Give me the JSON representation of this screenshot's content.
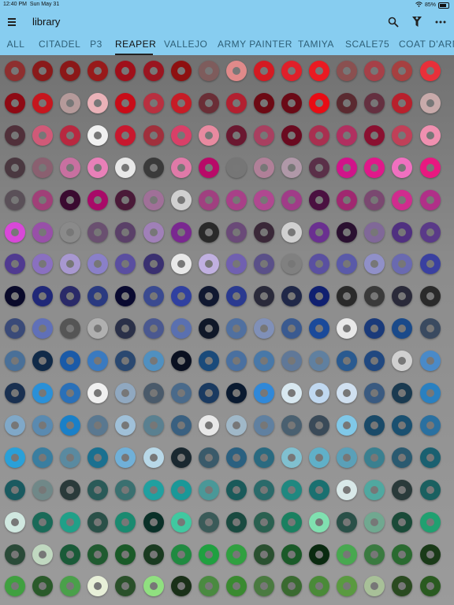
{
  "status_bar": {
    "time": "12:40 PM",
    "date": "Sun May 31",
    "battery": "85%"
  },
  "app_bar": {
    "title": "library"
  },
  "icons": {
    "menu": "hamburger-menu-icon",
    "search": "search-icon",
    "filter": "filter-icon",
    "more": "more-options-icon"
  },
  "tabs": [
    {
      "label": "ALL",
      "active": false
    },
    {
      "label": "CITADEL",
      "active": false
    },
    {
      "label": "P3",
      "active": false
    },
    {
      "label": "REAPER",
      "active": true
    },
    {
      "label": "VALLEJO",
      "active": false
    },
    {
      "label": "ARMY PAINTER",
      "active": false
    },
    {
      "label": "TAMIYA",
      "active": false
    },
    {
      "label": "SCALE75",
      "active": false
    },
    {
      "label": "COAT D'ARM",
      "active": false
    }
  ],
  "swatch_rows": [
    [
      "#8e2f2f",
      "#8a1a1a",
      "#8b1818",
      "#981a1a",
      "#a0101a",
      "#9a1520",
      "#8e1010",
      "#7e5c5c",
      "#e08a8a",
      "#d41a22",
      "#e0202a",
      "#ea1a22",
      "#8a5050",
      "#a64048",
      "#a64040",
      "#e8303a"
    ],
    [
      "#8e0a14",
      "#c6161e",
      "#b59a9a",
      "#eab2b8",
      "#c80c18",
      "#b83040",
      "#c61c26",
      "#6a2e36",
      "#b22030",
      "#6c0a14",
      "#6a0a16",
      "#e80c14",
      "#5a2a30",
      "#643040",
      "#b8202c",
      "#c8aaaa"
    ],
    [
      "#50303a",
      "#d05a78",
      "#b82840",
      "#f0f0f0",
      "#c8182e",
      "#a0303c",
      "#d84068",
      "#e88aa0",
      "#6a1830",
      "#a84060",
      "#6a0a20",
      "#a83050",
      "#b03060",
      "#8a1030",
      "#c04058",
      "#f090b0"
    ],
    [
      "#4a3840",
      "#8a6070",
      "#c870a0",
      "#e880b8",
      "#e8e8e8",
      "#3a3a3a",
      "#e07aa8",
      "#b80a68",
      "#767676",
      "#b08098",
      "#b098a8",
      "#5a3048",
      "#d0148a",
      "#e0188a",
      "#f070c0",
      "#e81880"
    ],
    [
      "#5a5058",
      "#a04078",
      "#3a0a30",
      "#a80a68",
      "#4a1a38",
      "#a07098",
      "#d0d0d0",
      "#a04080",
      "#a84088",
      "#b04890",
      "#a03c88",
      "#4a1040",
      "#a02870",
      "#7a4870",
      "#d02c8e",
      "#b03088"
    ],
    [
      "#d848d8",
      "#9850a8",
      "#8a8a8a",
      "#6a5070",
      "#5a4068",
      "#a080b8",
      "#7a2890",
      "#2a2a2a",
      "#6a4a78",
      "#3a2838",
      "#d0d0d0",
      "#6a3090",
      "#2a1030",
      "#806898",
      "#503080",
      "#5a3a88"
    ],
    [
      "#503a90",
      "#8a70c0",
      "#a898d0",
      "#8a80c8",
      "#5a4ea0",
      "#3a3070",
      "#e8e8e8",
      "#c0b0e0",
      "#7060b0",
      "#5a5088",
      "#808080",
      "#5a50a0",
      "#5a5aa8",
      "#9090c8",
      "#6a6ab0",
      "#3a40a0"
    ],
    [
      "#0a0a2a",
      "#202878",
      "#2a2a68",
      "#2a3a80",
      "#0a0a30",
      "#3a4a90",
      "#3040a0",
      "#101830",
      "#2a3a90",
      "#2a2a3a",
      "#202848",
      "#102070",
      "#2a2a2a",
      "#3a3a3a",
      "#2a2a3a",
      "#2a2a2a"
    ],
    [
      "#3a4a78",
      "#6070b8",
      "#555555",
      "#b0b0b0",
      "#2a3048",
      "#4a5890",
      "#5a70b0",
      "#101828",
      "#5070a0",
      "#8090b8",
      "#3a5a90",
      "#1a4a9a",
      "#e8e8e8",
      "#1a3a7a",
      "#1a4a8a",
      "#3a4a60"
    ],
    [
      "#4a7098",
      "#102a48",
      "#1a5aa8",
      "#3a7ac0",
      "#2a4870",
      "#5090c0",
      "#0a1020",
      "#1a4a7a",
      "#4a70a0",
      "#4878a8",
      "#607898",
      "#6080a0",
      "#2a5a90",
      "#204880",
      "#d0d0d0",
      "#4a8ac8"
    ],
    [
      "#1a3050",
      "#2a90d8",
      "#2a70b8",
      "#f0f0f0",
      "#90a8c0",
      "#4a5a6a",
      "#4a6a8a",
      "#1a3a60",
      "#0a1a30",
      "#3088d8",
      "#d8e8f0",
      "#c0d8f0",
      "#d0e0f0",
      "#3a5a80",
      "#1a3a50",
      "#2a80c0"
    ],
    [
      "#80a8c8",
      "#5a8ab0",
      "#1a80c8",
      "#5a7890",
      "#a0c0d8",
      "#5a8090",
      "#3a6080",
      "#e8e8e8",
      "#a0b8c8",
      "#6080a0",
      "#4a6070",
      "#3a4a58",
      "#80c8e8",
      "#1a4a68",
      "#1a5070",
      "#2a70a0"
    ],
    [
      "#2aa0d8",
      "#3a7ea0",
      "#5a8aa0",
      "#1a7090",
      "#70b0d8",
      "#b8d8e8",
      "#1a2830",
      "#3a5a6a",
      "#2a6080",
      "#2a6a80",
      "#80c0d0",
      "#60b0c8",
      "#5aa0b8",
      "#3a8090",
      "#2a5a70",
      "#1a6070"
    ],
    [
      "#1a5a60",
      "#708888",
      "#2a3a3a",
      "#2a5a58",
      "#3a7070",
      "#20a0a0",
      "#1a9898",
      "#4a9898",
      "#1a5a5a",
      "#2a6a6a",
      "#208880",
      "#1a7070",
      "#d8e8e8",
      "#50a8a0",
      "#2a3a3a",
      "#1a6060"
    ],
    [
      "#d0e8e0",
      "#1a6a58",
      "#20a088",
      "#2a5048",
      "#1a8a70",
      "#0a3028",
      "#40c8a0",
      "#3a5a58",
      "#1a4a40",
      "#2a6050",
      "#1a8060",
      "#80e0b0",
      "#2a5048",
      "#70a890",
      "#1a4a38",
      "#20a070"
    ],
    [
      "#2a4a38",
      "#c0d8c0",
      "#1a5a38",
      "#205a30",
      "#1a5a28",
      "#1a3a20",
      "#208a40",
      "#20a040",
      "#30a040",
      "#2a5030",
      "#1a5a28",
      "#0a2a10",
      "#48a850",
      "#3a7a40",
      "#2a6a30",
      "#1a3a18"
    ],
    [
      "#40a040",
      "#2a5a2a",
      "#4aa04a",
      "#e8f0d8",
      "#2a502a",
      "#90e080",
      "#1a3018",
      "#4a8a40",
      "#3a8a30",
      "#4a7a40",
      "#3a6a30",
      "#4a8a38",
      "#5a9a40",
      "#a8c098",
      "#2a4a20",
      "#2a5a20"
    ]
  ]
}
